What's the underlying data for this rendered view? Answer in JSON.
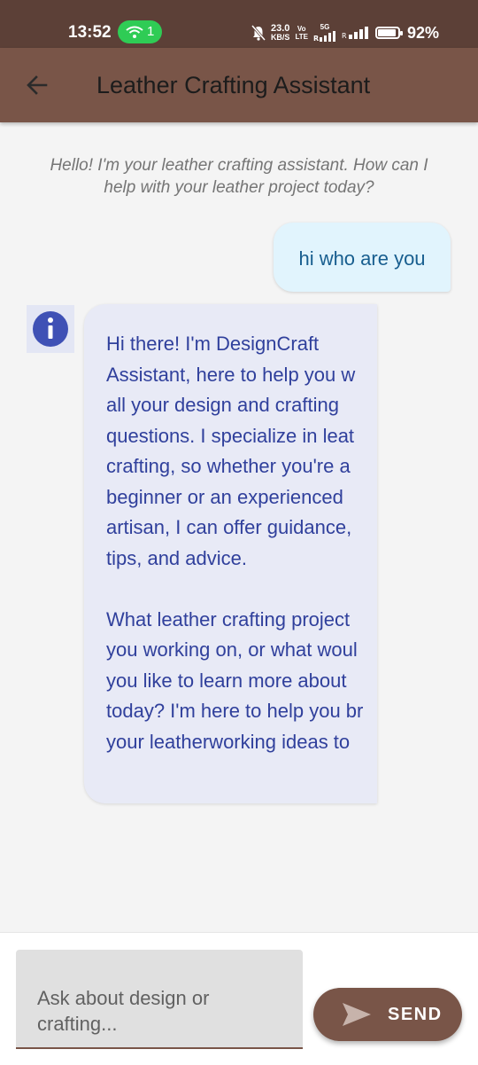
{
  "status_bar": {
    "time": "13:52",
    "wifi_count": "1",
    "net_speed_value": "23.0",
    "net_speed_unit": "KB/S",
    "volte_top": "Vo",
    "volte_bottom": "LTE",
    "network_5g": "5G",
    "battery_percent": "92%",
    "battery_level": 0.92
  },
  "app_bar": {
    "title": "Leather Crafting Assistant",
    "back_icon": "arrow-back-icon"
  },
  "chat": {
    "intro": "Hello! I'm your leather crafting assistant. How can I help with your leather project today?",
    "user_message": "hi who are you",
    "assistant_icon": "info-icon",
    "assistant_lines_p1": [
      "Hi there! I'm DesignCraft",
      "Assistant, here to help you w",
      "all your design and crafting",
      "questions. I specialize in leat",
      "crafting, so whether you're a",
      "beginner or an experienced",
      "artisan, I can offer guidance,",
      "tips, and advice."
    ],
    "assistant_lines_p2": [
      "What leather crafting project",
      "you working on, or what woul",
      "you like to learn more about",
      "today? I'm here to help you br",
      "your leatherworking ideas to"
    ]
  },
  "composer": {
    "placeholder": "Ask about design or crafting...",
    "value": "",
    "send_label": "SEND",
    "send_icon": "send-icon"
  },
  "colors": {
    "status_bar": "#5c4037",
    "app_bar": "#795548",
    "user_bubble": "#e1f4fd",
    "assistant_bubble": "#e8eaf6",
    "assistant_text": "#30409c",
    "info_icon": "#3f51b5"
  }
}
